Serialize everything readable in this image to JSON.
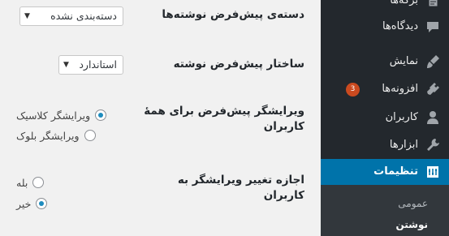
{
  "settings": {
    "default_category": {
      "label": "دسته‌ی پیش‌فرض نوشته‌ها",
      "selected": "دسته‌بندی نشده"
    },
    "default_format": {
      "label": "ساختار پیش‌فرض نوشته",
      "selected": "استاندارد"
    },
    "default_editor": {
      "label_line1": "ویرایشگر پیش‌فرض برای همهٔ",
      "label_line2": "کاربران",
      "options": [
        {
          "label": "ویرایشگر کلاسیک",
          "checked": true
        },
        {
          "label": "ویرایشگر بلوک",
          "checked": false
        }
      ]
    },
    "allow_switch": {
      "label_line1": "اجازه تغییر ویرایشگر به",
      "label_line2": "کاربران",
      "options": [
        {
          "label": "بله",
          "checked": false
        },
        {
          "label": "خیر",
          "checked": true
        }
      ]
    }
  },
  "sidebar": {
    "items": [
      {
        "label": "برگه‌ها",
        "icon": "pages-icon"
      },
      {
        "label": "دیدگاه‌ها",
        "icon": "comments-icon"
      },
      {
        "label": "نمایش",
        "icon": "appearance-brush-icon"
      },
      {
        "label": "افزونه‌ها",
        "icon": "plugins-icon",
        "badge": "3"
      },
      {
        "label": "کاربران",
        "icon": "users-icon"
      },
      {
        "label": "ابزارها",
        "icon": "tools-wrench-icon"
      },
      {
        "label": "تنظیمات",
        "icon": "settings-icon",
        "active": true
      }
    ],
    "submenu": [
      {
        "label": "عمومی"
      },
      {
        "label": "نوشتن",
        "current": true
      }
    ]
  },
  "colors": {
    "sidebar_bg": "#23282d",
    "active_bg": "#0073aa",
    "badge_bg": "#ca4a1f",
    "radio_checked": "#1e8cbe"
  }
}
